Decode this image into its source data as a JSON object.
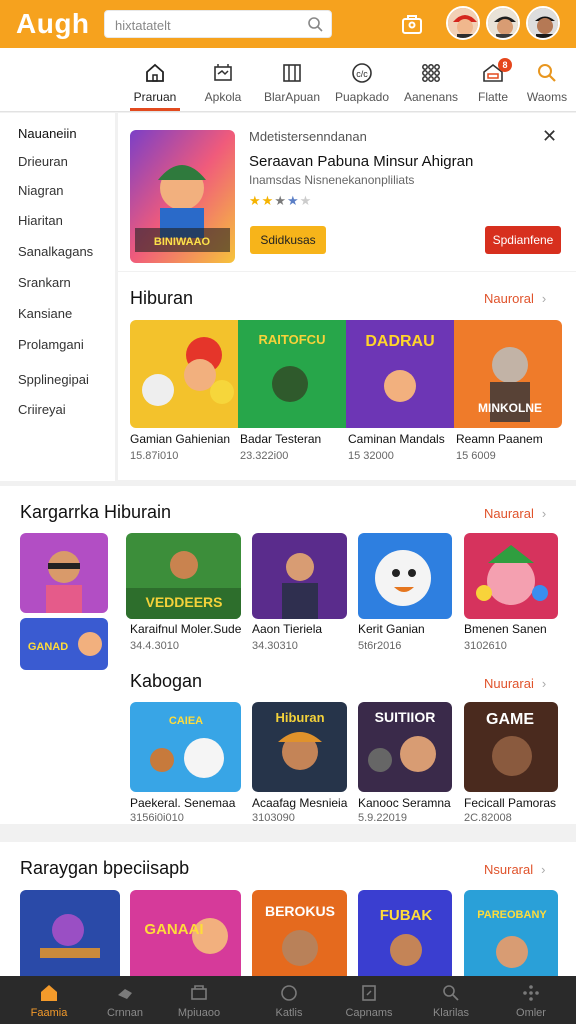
{
  "header": {
    "brand": "Augh",
    "search_placeholder": "hixtatatelt",
    "accent_color": "#f6a21e",
    "icons": [
      "search-icon",
      "cart-icon",
      "avatar",
      "avatar",
      "avatar"
    ]
  },
  "nav": {
    "items": [
      {
        "label": "Praruan",
        "icon": "home-icon",
        "active": true
      },
      {
        "label": "Apkola",
        "icon": "apps-icon"
      },
      {
        "label": "BlarApuan",
        "icon": "book-icon"
      },
      {
        "label": "Puapkado",
        "icon": "coin-icon"
      },
      {
        "label": "Aanenans",
        "icon": "grid-icon"
      },
      {
        "label": "Flatte",
        "icon": "store-icon",
        "badge": "8"
      },
      {
        "label": "Waoms",
        "icon": "search-icon"
      }
    ]
  },
  "sidebar": {
    "items": [
      "Nauaneiin",
      "Drieuran",
      "Niagran",
      "Hiaritan",
      "Sanalkagans",
      "Srankarn",
      "Kansiane",
      "Prolamgani",
      "Spplinegipai",
      "Criireyai"
    ]
  },
  "promo": {
    "overline": "Mdetistersenndanan",
    "title": "Seraavan Pabuna Minsur Ahigran",
    "subtitle": "Inamsdas Nisnenekanonpliliats",
    "rating": 4,
    "btn_left": "Sdidkusas",
    "btn_right": "Spdianfene",
    "thumb_text": "BINIWAAO"
  },
  "hiburan": {
    "title": "Hiburan",
    "more": "Nauroral",
    "items": [
      {
        "caption": "Gamian Gahienian",
        "count": "15.87i010"
      },
      {
        "caption": "Badar Testeran",
        "count": "23.322i00"
      },
      {
        "caption": "Caminan Mandals",
        "count": "15 32000"
      },
      {
        "caption": "Reamn Paanem",
        "count": "15 6009"
      }
    ],
    "banner_texts": [
      "RAITOFCU",
      "DADRAU",
      "MINKOLNE"
    ]
  },
  "kargarrka": {
    "title": "Kargarrka Hiburain",
    "more": "Nauraral",
    "side_label": "GANAD",
    "items": [
      {
        "caption": "Karaifnul Moler.Sude",
        "count": "34.4.3010",
        "art": "VEDDEERS"
      },
      {
        "caption": "Aaon Tieriela",
        "count": "34.30310",
        "art": ""
      },
      {
        "caption": "Kerit Ganian",
        "count": "5t6r2016",
        "art": ""
      },
      {
        "caption": "Bmenen Sanen",
        "count": "3102610",
        "art": ""
      }
    ]
  },
  "kabogan": {
    "title": "Kabogan",
    "more": "Nuurarai",
    "items": [
      {
        "caption": "Paekeral. Senemaa",
        "count": "3156i0i010",
        "art": "CAIEA"
      },
      {
        "caption": "Acaafag Mesnieia",
        "count": "3103090",
        "art": "Hiburan"
      },
      {
        "caption": "Kanooc Seramna",
        "count": "5.9.22019",
        "art": "SUITIIOR"
      },
      {
        "caption": "Fecicall Pamoras",
        "count": "2C.82008",
        "art": "GAME"
      }
    ]
  },
  "rarayagan": {
    "title": "Raraygan bpeciisapb",
    "more": "Nsuraral",
    "arts": [
      "",
      "GANAAI",
      "BEROKUS",
      "FUBAK",
      "PAREOBANY"
    ]
  },
  "bottombar": {
    "items": [
      {
        "label": "Faamia",
        "icon": "home-icon",
        "active": true
      },
      {
        "label": "Crnnan",
        "icon": "fire-icon"
      },
      {
        "label": "Mpiuaoo",
        "icon": "store-icon"
      },
      {
        "label": "Katlis",
        "icon": "circle-icon"
      },
      {
        "label": "Capnams",
        "icon": "box-icon"
      },
      {
        "label": "Klarilas",
        "icon": "search-icon"
      },
      {
        "label": "Omler",
        "icon": "more-icon"
      }
    ]
  }
}
